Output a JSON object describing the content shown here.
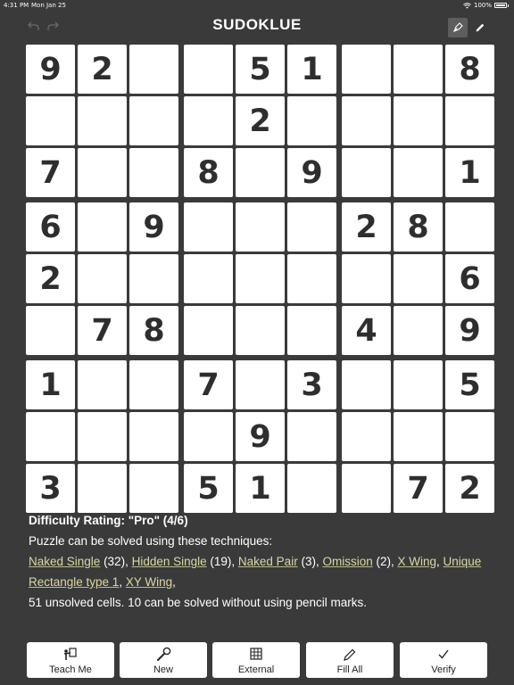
{
  "status": {
    "time": "4:31 PM",
    "date": "Mon Jan 25",
    "battery": "100%"
  },
  "header": {
    "title": "SUDOKLUE"
  },
  "icons": {
    "undo": "undo-arrow-icon",
    "redo": "redo-arrow-icon",
    "pen": "pen-nib-icon",
    "pencil": "pencil-icon",
    "teach": "presenter-board-icon",
    "new": "wrench-icon",
    "external": "grid-icon",
    "fill_all": "pencil-icon",
    "verify": "checkmark-icon"
  },
  "grid": {
    "rows": [
      [
        "9",
        "2",
        "",
        "",
        "5",
        "1",
        "",
        "",
        "8"
      ],
      [
        "",
        "",
        "",
        "",
        "2",
        "",
        "",
        "",
        ""
      ],
      [
        "7",
        "",
        "",
        "8",
        "",
        "9",
        "",
        "",
        "1"
      ],
      [
        "6",
        "",
        "9",
        "",
        "",
        "",
        "2",
        "8",
        ""
      ],
      [
        "2",
        "",
        "",
        "",
        "",
        "",
        "",
        "",
        "6"
      ],
      [
        "",
        "7",
        "8",
        "",
        "",
        "",
        "4",
        "",
        "9"
      ],
      [
        "1",
        "",
        "",
        "7",
        "",
        "3",
        "",
        "",
        "5"
      ],
      [
        "",
        "",
        "",
        "",
        "9",
        "",
        "",
        "",
        ""
      ],
      [
        "3",
        "",
        "",
        "5",
        "1",
        "",
        "",
        "7",
        "2"
      ]
    ]
  },
  "info": {
    "difficulty": "Difficulty Rating: \"Pro\" (4/6)",
    "intro": "Puzzle can be solved using these techniques:",
    "techniques": [
      {
        "name": "Naked Single",
        "count": " (32), "
      },
      {
        "name": "Hidden Single",
        "count": " (19), "
      },
      {
        "name": "Naked Pair",
        "count": " (3), "
      },
      {
        "name": "Omission",
        "count": " (2), "
      },
      {
        "name": "X Wing",
        "count": ", "
      },
      {
        "name": "Unique Rectangle type 1",
        "count": ", "
      },
      {
        "name": "XY Wing",
        "count": ","
      }
    ],
    "summary": "51 unsolved cells. 10 can be solved without using pencil marks."
  },
  "toolbar": {
    "teach_me": "Teach Me",
    "new": "New",
    "external": "External",
    "fill_all": "Fill All",
    "verify": "Verify"
  },
  "colors": {
    "background": "#3a3a3a",
    "cell": "#ffffff",
    "digit": "#2e2e2e",
    "link": "#dcd7a4"
  }
}
